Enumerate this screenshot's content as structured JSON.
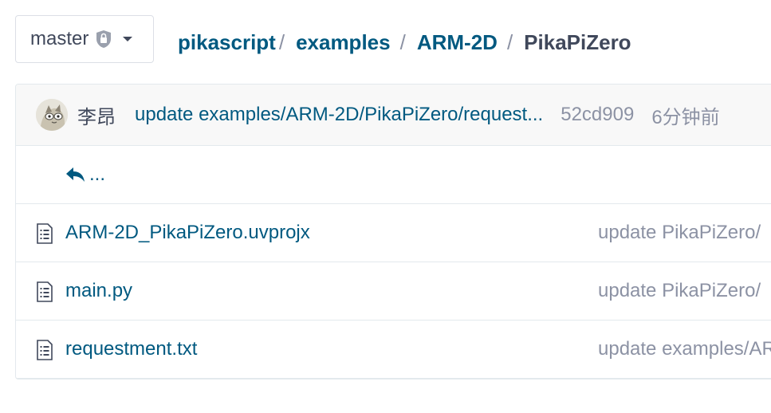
{
  "branch": {
    "label": "master",
    "lock_icon": "lock-shield-icon",
    "caret_icon": "caret-down-icon"
  },
  "breadcrumb": {
    "items": [
      "pikascript",
      "examples",
      "ARM-2D",
      "PikaPiZero"
    ],
    "separator": "/"
  },
  "latest_commit": {
    "author": "李昂",
    "message": "update examples/ARM-2D/PikaPiZero/request...",
    "sha": "52cd909",
    "time": "6分钟前"
  },
  "parent_link": {
    "icon": "reply-arrow-icon",
    "label": "..."
  },
  "files": [
    {
      "name": "ARM-2D_PikaPiZero.uvprojx",
      "commit": "update PikaPiZero/",
      "icon": "file-text-icon"
    },
    {
      "name": "main.py",
      "commit": "update PikaPiZero/",
      "icon": "file-text-icon"
    },
    {
      "name": "requestment.txt",
      "commit": "update examples/ARM",
      "icon": "file-text-icon"
    }
  ],
  "colors": {
    "link": "#005980",
    "text": "#40485b",
    "muted": "#8c92a4",
    "border": "#e3e9ed",
    "commit_bar_bg": "#f8f8f8"
  }
}
